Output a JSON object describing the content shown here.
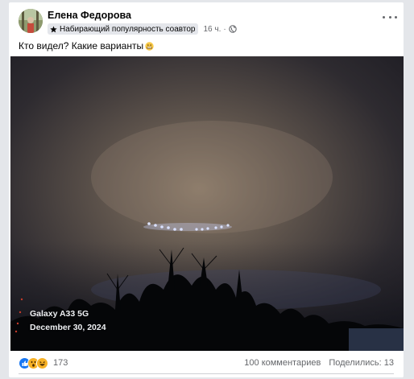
{
  "post": {
    "author": "Елена Федорова",
    "badge": "Набирающий популярность соавтор",
    "time": "16 ч.",
    "separator": "·",
    "text": "Кто видел? Какие варианты",
    "icons": {
      "badge": "star-icon",
      "audience": "globe-icon",
      "menu": "more-options-icon",
      "text_emoji": "grimacing-face-emoji"
    }
  },
  "image": {
    "overlay_device": "Galaxy A33 5G",
    "overlay_date": "December 30, 2024"
  },
  "reactions": {
    "icons": [
      "like-icon",
      "wow-icon",
      "haha-icon"
    ],
    "count": "173",
    "comments": "100 комментариев",
    "shares": "Поделились: 13"
  },
  "colors": {
    "like": "#1877f2",
    "wow": "#f7b125",
    "text_secondary": "#65676b"
  }
}
